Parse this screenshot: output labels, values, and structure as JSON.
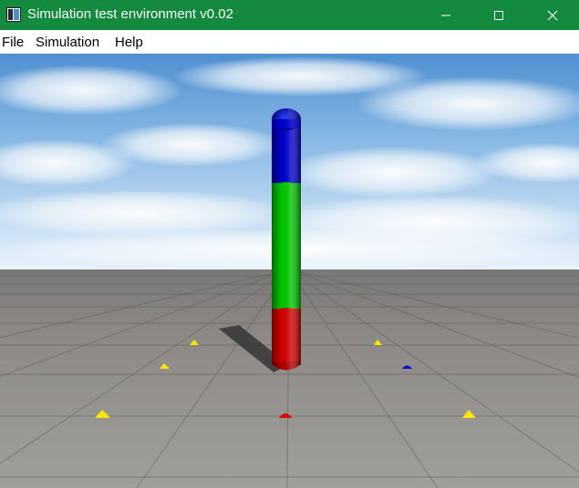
{
  "window": {
    "title": "Simulation test environment v0.02",
    "title_bar_color": "#138a3d"
  },
  "menu": {
    "file": "File",
    "simulation": "Simulation",
    "help": "Help"
  },
  "scene": {
    "capsule_segment_colors": [
      "#0000cc",
      "#00cc00",
      "#cc0000"
    ],
    "marker_colors": [
      "#ffee00",
      "#dd0000",
      "#0000cc"
    ]
  }
}
